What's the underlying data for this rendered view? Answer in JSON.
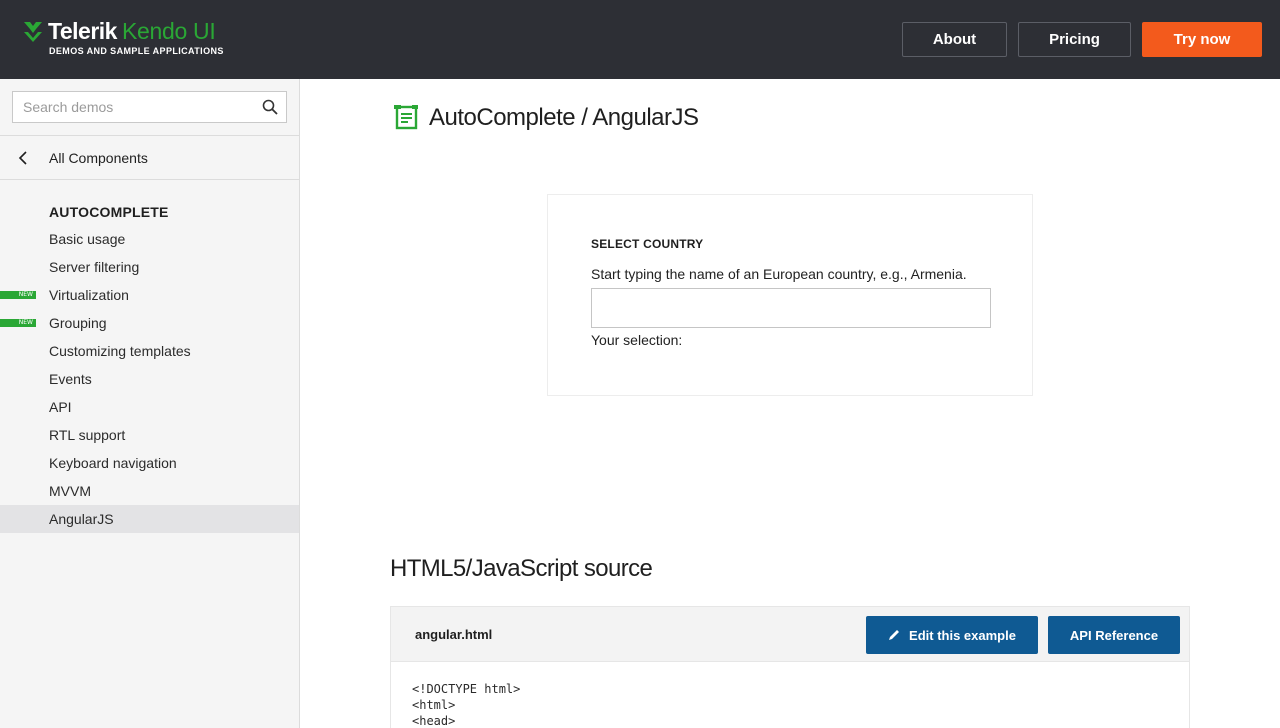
{
  "header": {
    "brand_name": "Telerik",
    "brand_product": "Kendo UI",
    "brand_subtitle": "DEMOS AND SAMPLE APPLICATIONS",
    "about_label": "About",
    "pricing_label": "Pricing",
    "try_label": "Try now"
  },
  "sidebar": {
    "search_placeholder": "Search demos",
    "back_label": "All Components",
    "section_title": "AUTOCOMPLETE",
    "items": [
      {
        "label": "Basic usage",
        "badge": ""
      },
      {
        "label": "Server filtering",
        "badge": ""
      },
      {
        "label": "Virtualization",
        "badge": "NEW"
      },
      {
        "label": "Grouping",
        "badge": "NEW"
      },
      {
        "label": "Customizing templates",
        "badge": ""
      },
      {
        "label": "Events",
        "badge": ""
      },
      {
        "label": "API",
        "badge": ""
      },
      {
        "label": "RTL support",
        "badge": ""
      },
      {
        "label": "Keyboard navigation",
        "badge": ""
      },
      {
        "label": "MVVM",
        "badge": ""
      },
      {
        "label": "AngularJS",
        "badge": "",
        "active": true
      }
    ]
  },
  "main": {
    "page_title": "AutoComplete / AngularJS",
    "demo": {
      "heading": "SELECT COUNTRY",
      "hint": "Start typing the name of an European country, e.g., Armenia.",
      "input_value": "",
      "selection_label": "Your selection:"
    },
    "source": {
      "title": "HTML5/JavaScript source",
      "filename": "angular.html",
      "edit_label": "Edit this example",
      "api_label": "API Reference",
      "code_lines": [
        "<!DOCTYPE html>",
        "<html>",
        "<head>"
      ]
    }
  },
  "colors": {
    "header_bg": "#2d2f35",
    "brand_green": "#2aa735",
    "try_orange": "#f35a1c",
    "button_blue": "#0f5a93"
  }
}
